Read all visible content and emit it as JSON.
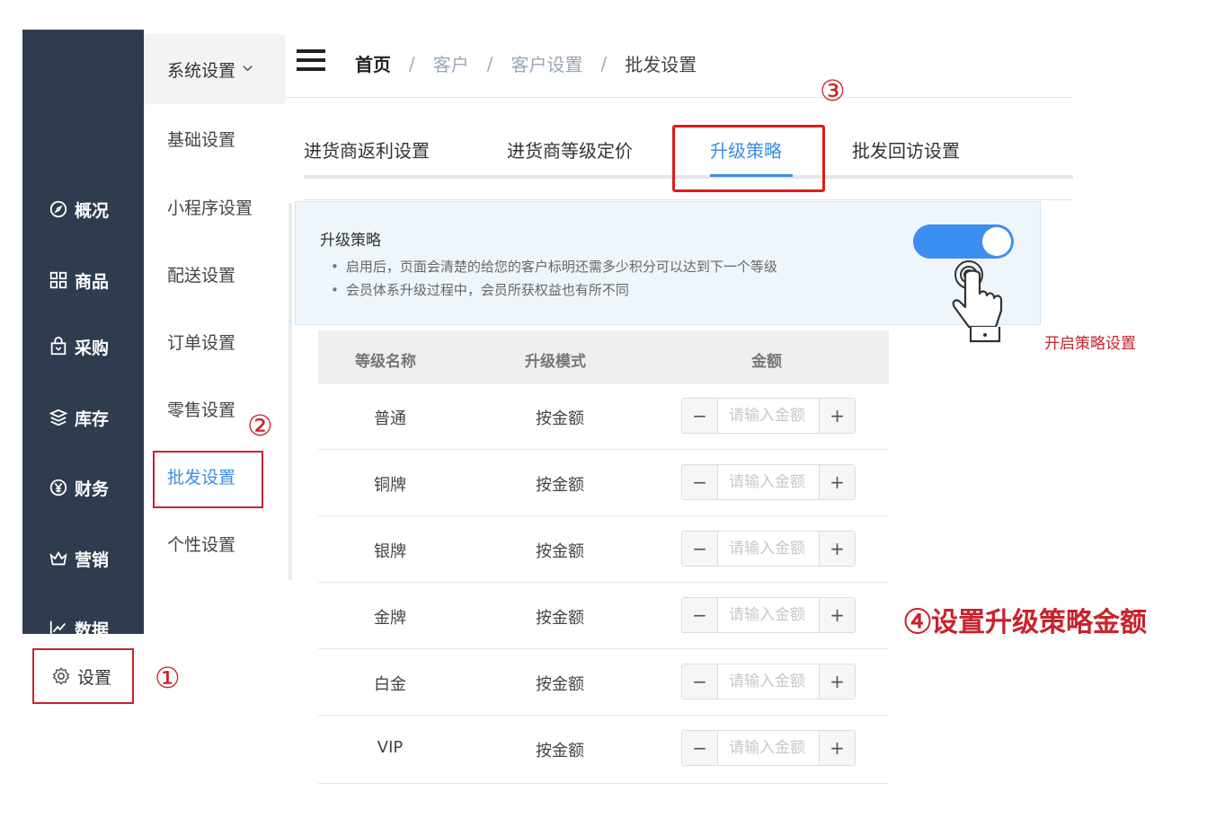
{
  "nav": {
    "items": [
      {
        "label": "概况",
        "icon": "compass-icon"
      },
      {
        "label": "商品",
        "icon": "grid-icon"
      },
      {
        "label": "采购",
        "icon": "bag-icon"
      },
      {
        "label": "库存",
        "icon": "layers-icon"
      },
      {
        "label": "财务",
        "icon": "yen-icon"
      },
      {
        "label": "营销",
        "icon": "crown-icon"
      },
      {
        "label": "数据",
        "icon": "chart-icon"
      }
    ],
    "settings_label": "设置"
  },
  "submenu": {
    "header": "系统设置",
    "items": [
      "基础设置",
      "小程序设置",
      "配送设置",
      "订单设置",
      "零售设置",
      "批发设置",
      "个性设置"
    ],
    "active": "批发设置"
  },
  "breadcrumb": {
    "home": "首页",
    "items": [
      "客户",
      "客户设置"
    ],
    "current": "批发设置",
    "separator": "/"
  },
  "tabs": [
    {
      "label": "进货商返利设置",
      "active": false
    },
    {
      "label": "进货商等级定价",
      "active": false
    },
    {
      "label": "升级策略",
      "active": true
    },
    {
      "label": "批发回访设置",
      "active": false
    }
  ],
  "strategy": {
    "title": "升级策略",
    "bullets": [
      "启用后，页面会清楚的给您的客户标明还需多少积分可以达到下一个等级",
      "会员体系升级过程中，会员所获权益也有所不同"
    ],
    "enabled": true,
    "hint": "开启策略设置"
  },
  "table": {
    "headers": [
      "等级名称",
      "升级模式",
      "金额"
    ],
    "rows": [
      {
        "name": "普通",
        "mode": "按金额"
      },
      {
        "name": "铜牌",
        "mode": "按金额"
      },
      {
        "name": "银牌",
        "mode": "按金额"
      },
      {
        "name": "金牌",
        "mode": "按金额"
      },
      {
        "name": "白金",
        "mode": "按金额"
      },
      {
        "name": "VIP",
        "mode": "按金额"
      }
    ],
    "amount_placeholder": "请输入金额",
    "minus": "−",
    "plus": "+"
  },
  "annotations": {
    "step1": "①",
    "step2": "②",
    "step3": "③",
    "step4": "④设置升级策略金额"
  },
  "colors": {
    "nav_bg": "#2f3b4e",
    "accent": "#3b8ee8",
    "annotation": "#c8232c",
    "info_bg": "#eef6fc"
  }
}
